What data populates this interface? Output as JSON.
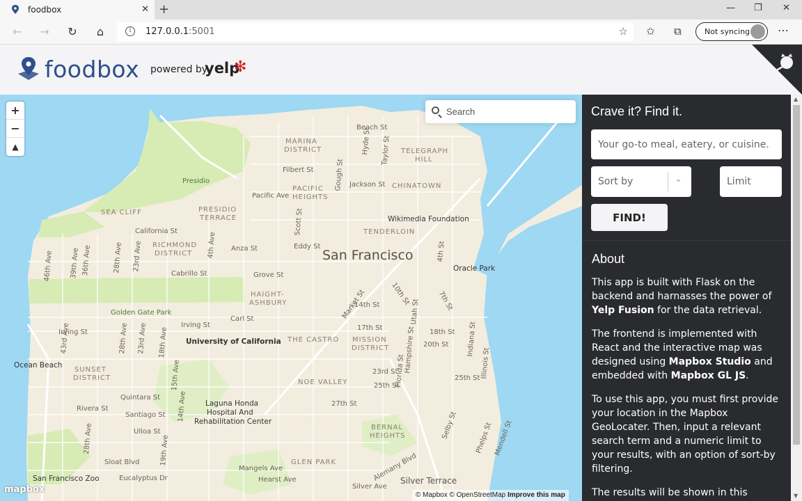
{
  "browser": {
    "tab_title": "foodbox",
    "url_host": "127.0.0.1",
    "url_port": ":5001",
    "sync_label": "Not syncing"
  },
  "header": {
    "brand": "foodbox",
    "powered_by": "powered by",
    "yelp": "yelp"
  },
  "map": {
    "search_placeholder": "Search",
    "city_label": "San Francisco",
    "labels": {
      "marina": "MARINA",
      "district": "DISTRICT",
      "telegraph": "TELEGRAPH",
      "hill": "HILL",
      "presidio": "Presidio",
      "pacific": "PACIFIC",
      "heights": "HEIGHTS",
      "chinatown": "CHINATOWN",
      "sea_cliff": "SEA CLIFF",
      "presidio_terrace_1": "PRESIDIO",
      "presidio_terrace_2": "TERRACE",
      "wikimedia": "Wikimedia Foundation",
      "tenderloin": "TENDERLOIN",
      "richmond_1": "RICHMOND",
      "richmond_2": "DISTRICT",
      "oracle_park": "Oracle Park",
      "haight_1": "HAIGHT-",
      "haight_2": "ASHBURY",
      "golden_gate_park": "Golden Gate Park",
      "ucsf": "University of California",
      "castro": "THE CASTRO",
      "mission_1": "MISSION",
      "mission_2": "DISTRICT",
      "ocean_beach": "Ocean Beach",
      "sunset_1": "SUNSET",
      "sunset_2": "DISTRICT",
      "noe_valley": "NOE VALLEY",
      "laguna_1": "Laguna Honda",
      "laguna_2": "Hospital And",
      "laguna_3": "Rehabilitation Center",
      "bernal_1": "BERNAL",
      "bernal_2": "HEIGHTS",
      "glen_park": "GLEN PARK",
      "sf_zoo": "San Francisco Zoo",
      "silver_terrace": "Silver Terrace",
      "beach_st": "Beach St",
      "filbert_st": "Filbert St",
      "jackson_st": "Jackson St",
      "pacific_ave": "Pacific Ave",
      "california_st": "California St",
      "anza_st": "Anza St",
      "eddy_st": "Eddy St",
      "grove_st": "Grove St",
      "cabrillo_st": "Cabrillo St",
      "carl_st": "Carl St",
      "irving_st_1": "Irving St",
      "irving_st_2": "Irving St",
      "market_st": "Market St",
      "14th_st": "14th St",
      "17th_st": "17th St",
      "18th_st": "18th St",
      "20th_st": "20th St",
      "23rd_st": "23rd St",
      "25th_st_1": "25th St",
      "25th_st_2": "25th St",
      "27th_st": "27th St",
      "quintara_st": "Quintara St",
      "santiago_st": "Santiago St",
      "rivera_st": "Rivera St",
      "ulloa_st": "Ulloa St",
      "sloat_blvd": "Sloat Blvd",
      "eucalyptus_dr": "Eucalyptus Dr",
      "mangels_ave": "Mangels Ave",
      "hearst_ave": "Hearst Ave",
      "silver_ave": "Silver Ave",
      "alemany_blvd": "Alemany Blvd",
      "hyde_st": "Hyde St",
      "taylor_st": "Taylor St",
      "gough_st": "Gough St",
      "scott_st": "Scott St",
      "4th_ave": "4th Ave",
      "23rd_ave": "23rd Ave",
      "28th_ave": "28th Ave",
      "36th_ave": "36th Ave",
      "39th_ave": "39th Ave",
      "46th_ave": "46th Ave",
      "43rd_ave": "43rd Ave",
      "28th_ave_2": "28th Ave",
      "23rd_ave_2": "23rd Ave",
      "18th_ave": "18th Ave",
      "15th_ave": "15th Ave",
      "14th_ave": "14th Ave",
      "19th_ave": "19th Ave",
      "28th_ave_3": "28th Ave",
      "4th_st": "4th St",
      "7th_st": "7th St",
      "10th_st": "10th St",
      "utah_st": "Utah St",
      "hampshire_st": "Hampshire St",
      "florida_st": "Florida St",
      "indiana_st": "Indiana St",
      "illinois_st": "Illinois St",
      "selby_st": "Selby St",
      "phelps_st": "Phelps St",
      "mendell_st": "Mendell St"
    },
    "attribution": "© Mapbox © OpenStreetMap",
    "improve": "Improve this map",
    "mapbox_logo": "mapbox"
  },
  "sidebar": {
    "heading": "Crave it? Find it.",
    "term_placeholder": "Your go-to meal, eatery, or cuisine.",
    "sort_label": "Sort by",
    "limit_placeholder": "Limit",
    "find_label": "FIND!",
    "about_title": "About",
    "p1_a": "This app is built with Flask on the backend and harnasses the power of ",
    "p1_b": "Yelp Fusion",
    "p1_c": " for the data retrieval.",
    "p2_a": "The frontend is implemented with React and the interactive map was designed using ",
    "p2_b": "Mapbox Studio",
    "p2_c": " and embedded with ",
    "p2_d": "Mapbox GL JS",
    "p2_e": ".",
    "p3": "To use this app, you must first provide your location in the Mapbox GeoLocater. Then, input a relevant search term and a numeric limit to your results, with an option of sort-by filtering.",
    "p4": "The results will be shown in this sidebar"
  },
  "colors": {
    "water": "#9ed8f2",
    "land": "#f3eddf",
    "park": "#d7ebb4",
    "sidebar_bg": "#2a2b2f",
    "brand_blue": "#2f4e8c",
    "yelp_red": "#d32323"
  }
}
